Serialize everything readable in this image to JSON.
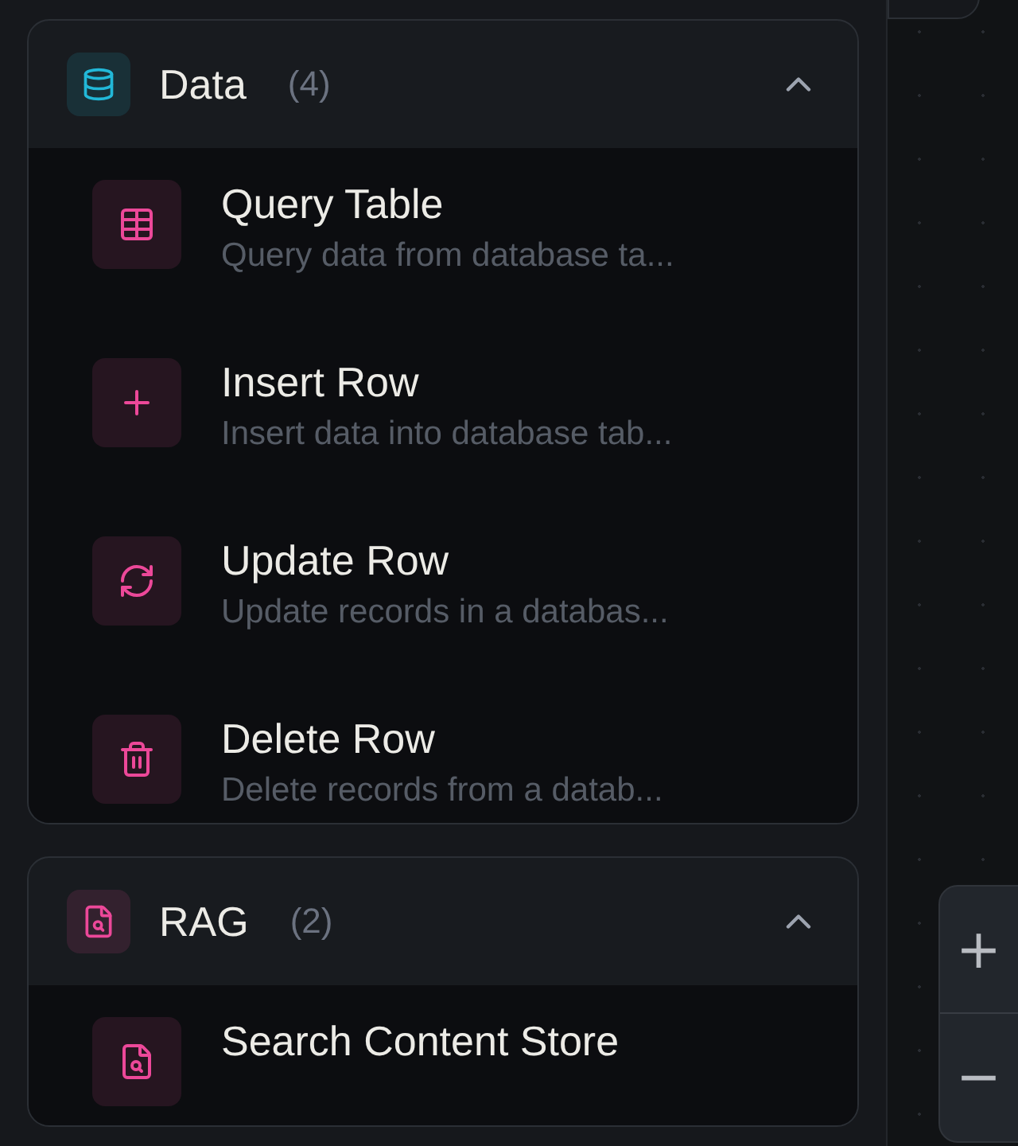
{
  "sections": [
    {
      "title": "Data",
      "count": "(4)",
      "color": "#22b8d8",
      "kind": "database",
      "expanded": true,
      "items": [
        {
          "title": "Query Table",
          "description": "Query data from database ta...",
          "kind": "table"
        },
        {
          "title": "Insert Row",
          "description": "Insert data into database tab...",
          "kind": "plus"
        },
        {
          "title": "Update Row",
          "description": "Update records in a databas...",
          "kind": "refresh"
        },
        {
          "title": "Delete Row",
          "description": "Delete records from a datab...",
          "kind": "trash"
        }
      ]
    },
    {
      "title": "RAG",
      "count": "(2)",
      "color": "#ec4899",
      "kind": "file-search",
      "expanded": true,
      "items": [
        {
          "title": "Search Content Store",
          "kind": "file-search"
        }
      ]
    }
  ],
  "zoom_controls": [
    "+",
    "−"
  ]
}
